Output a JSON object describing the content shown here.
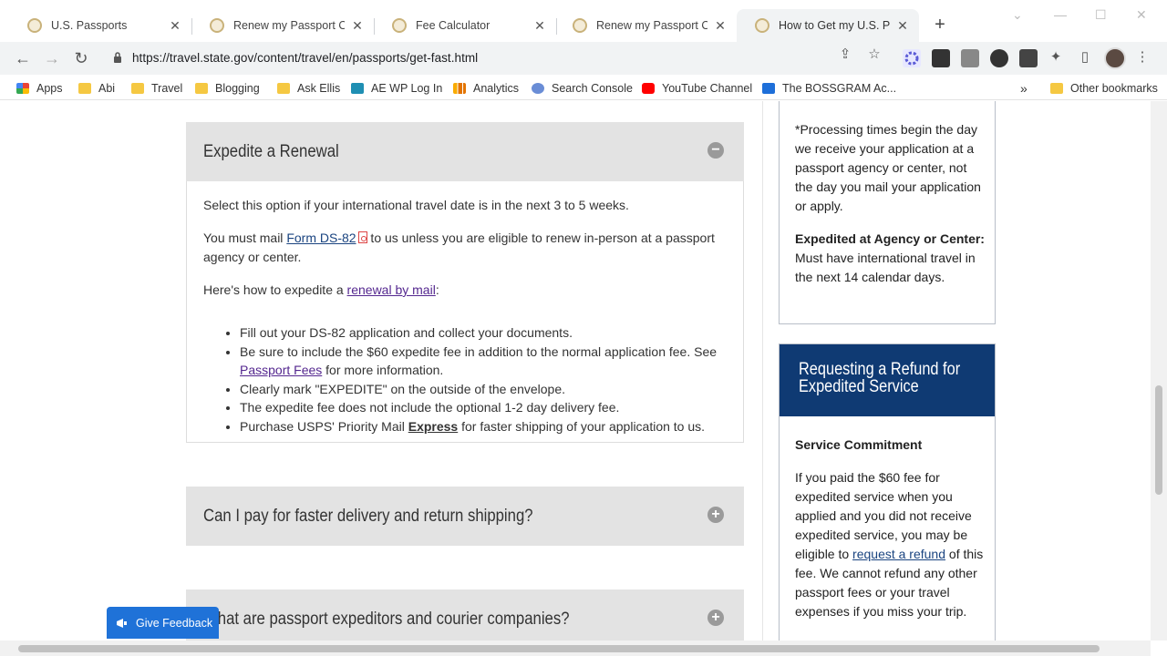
{
  "browser": {
    "tabs": [
      {
        "title": "U.S. Passports"
      },
      {
        "title": "Renew my Passport Online"
      },
      {
        "title": "Fee Calculator"
      },
      {
        "title": "Renew my Passport Online"
      },
      {
        "title": "How to Get my U.S. Passport"
      }
    ],
    "url": "https://travel.state.gov/content/travel/en/passports/get-fast.html",
    "bookmarks": [
      {
        "label": "Apps"
      },
      {
        "label": "Abi"
      },
      {
        "label": "Travel"
      },
      {
        "label": "Blogging"
      },
      {
        "label": "Ask Ellis"
      },
      {
        "label": "AE WP Log In"
      },
      {
        "label": "Analytics"
      },
      {
        "label": "Search Console"
      },
      {
        "label": "YouTube Channel"
      },
      {
        "label": "The BOSSGRAM Ac..."
      },
      {
        "label": "Other bookmarks"
      }
    ],
    "more_bookmarks": "»"
  },
  "main": {
    "section1": {
      "title": "Expedite a Renewal",
      "intro": "Select this option if your international travel date is in the next 3 to 5 weeks.",
      "mail_pre": "You must mail ",
      "mail_link": "Form DS-82",
      "mail_post": " to us unless you are eligible to renew in-person at a passport agency or center.",
      "howto_pre": "Here's how to expedite a ",
      "howto_link": "renewal by mail",
      "howto_post": ":",
      "bullets": {
        "b1": "Fill out your DS-82 application and collect your documents.",
        "b2_pre": "Be sure to include the $60 expedite fee in addition to the normal application fee. See ",
        "b2_link": "Passport Fees",
        "b2_post": " for more information.",
        "b3": "Clearly mark \"EXPEDITE\" on the outside of the envelope.",
        "b4": "The expedite fee does not include the optional 1-2 day delivery fee.",
        "b5_pre": "Purchase USPS' Priority Mail ",
        "b5_link": "Express",
        "b5_post": " for faster shipping of your application to us."
      }
    },
    "section2": {
      "title": "Can I pay for faster delivery and return shipping?"
    },
    "section3": {
      "title": "What are passport expeditors and courier companies?"
    }
  },
  "sidebar": {
    "processing_note": "*Processing times begin the day we receive your application at a passport agency or center, not the day you mail your application or apply.",
    "expedited_label": "Expedited at Agency or Center:",
    "expedited_text": " Must have international travel in the next 14 calendar days.",
    "refund": {
      "title": "Requesting a Refund for Expedited Service",
      "commitment_label": "Service Commitment",
      "text_pre": "If you paid the $60 fee for expedited service when you applied and you did not receive expedited service, you may be eligible to ",
      "link": "request a refund",
      "text_post": " of this fee. We cannot refund any other passport fees or your travel expenses if you miss your trip."
    }
  },
  "feedback": {
    "label": "Give Feedback"
  },
  "icons": {
    "back": "back-arrow-icon",
    "forward": "forward-arrow-icon",
    "reload": "reload-icon",
    "share": "share-icon",
    "star": "star-icon",
    "extensions": "puzzle-icon"
  }
}
